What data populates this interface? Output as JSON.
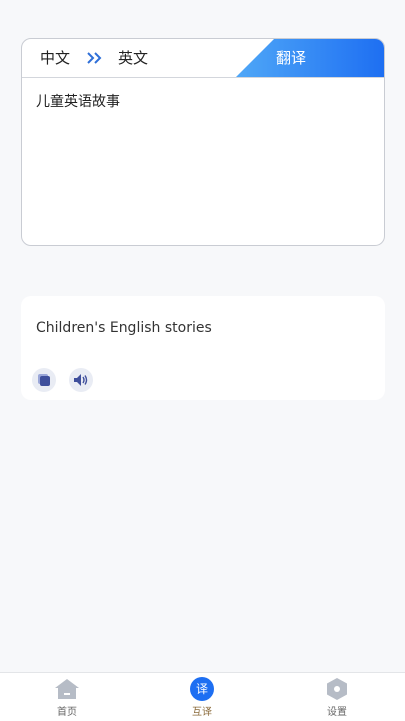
{
  "translator": {
    "source_lang": "中文",
    "target_lang": "英文",
    "translate_label": "翻译",
    "source_text": "儿童英语故事"
  },
  "result": {
    "text": "Children's English stories"
  },
  "tabbar": {
    "items": [
      {
        "label": "首页",
        "icon": "home-icon"
      },
      {
        "label": "互译",
        "icon": "translate-icon",
        "glyph": "译"
      },
      {
        "label": "设置",
        "icon": "settings-icon"
      }
    ]
  },
  "colors": {
    "accent": "#1e6ff2",
    "accent_light": "#4fa7f7",
    "background": "#f7f8fa"
  }
}
